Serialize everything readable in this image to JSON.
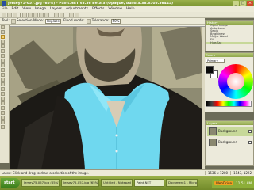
{
  "window": {
    "title": "Jersey75-057.jpg (65%) - Paint.NET v3.36 Beta 3 (Opaque, build 3.36.3505.36445)"
  },
  "menu": [
    "File",
    "Edit",
    "View",
    "Image",
    "Layers",
    "Adjustments",
    "Effects",
    "Window",
    "Help"
  ],
  "tool_options": {
    "tool_label": "Tool:",
    "selection_mode_label": "Selection Mode:",
    "selection_mode_value": "Replace",
    "flood_mode_label": "Flood mode:",
    "tolerance_label": "Tolerance:",
    "tolerance_value": "50%"
  },
  "history": {
    "title": "History",
    "items": [
      "Open Image",
      "Auto-Level",
      "Sepia",
      "Brightness",
      "Magic Wand",
      "Fill",
      "Hue/Sat"
    ]
  },
  "colors": {
    "title": "Colors",
    "mode": "Primary",
    "more_label": "More >>",
    "primary_color": "#0a0a0a",
    "secondary_color": "#ffffff"
  },
  "layers": {
    "title": "Layers",
    "items": [
      "Background",
      "Background"
    ]
  },
  "status": {
    "message": "Lasso: Click and drag to draw a selection of the image.",
    "image_size": "1536 x 1280",
    "cursor_pos": "1143, 1222"
  },
  "taskbar": {
    "start_label": "start",
    "tasks": [
      "Jersey75-057.jpg (65%)...",
      "Jersey75-057.jpg (65%)...",
      "Untitled - Notepad",
      "Paint.NET",
      "Document1 - Microsoft..."
    ],
    "tray_app": "WebDrive",
    "clock": "11:51 AM"
  }
}
